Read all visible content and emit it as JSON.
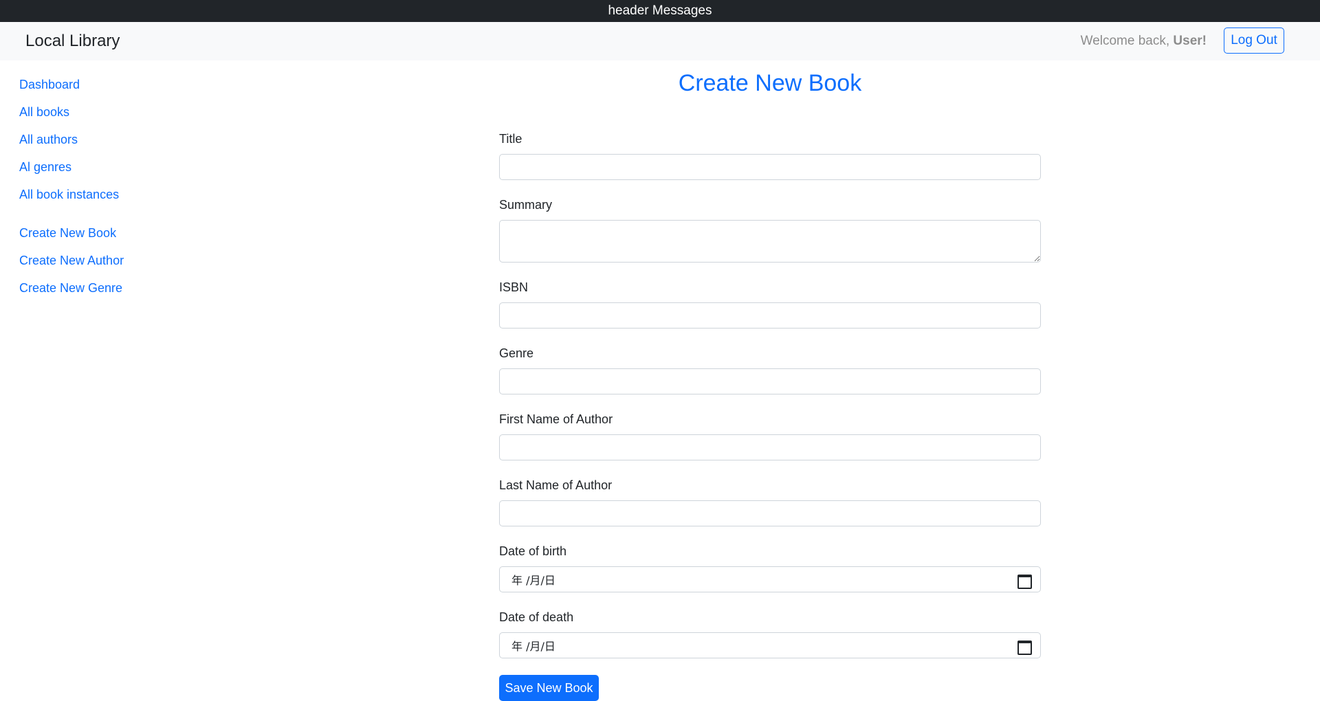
{
  "topbar": {
    "text": "header Messages"
  },
  "navbar": {
    "brand": "Local Library",
    "welcome_prefix": "Welcome back, ",
    "username": "User!",
    "logout_label": "Log Out"
  },
  "sidebar": {
    "links": [
      {
        "label": "Dashboard"
      },
      {
        "label": "All books"
      },
      {
        "label": "All authors"
      },
      {
        "label": "Al genres"
      },
      {
        "label": "All book instances"
      }
    ],
    "create_links": [
      {
        "label": "Create New Book"
      },
      {
        "label": "Create New Author"
      },
      {
        "label": "Create New Genre"
      }
    ]
  },
  "form": {
    "title": "Create New Book",
    "fields": {
      "title": {
        "label": "Title",
        "value": ""
      },
      "summary": {
        "label": "Summary",
        "value": ""
      },
      "isbn": {
        "label": "ISBN",
        "value": ""
      },
      "genre": {
        "label": "Genre",
        "value": ""
      },
      "first_name": {
        "label": "First Name of Author",
        "value": ""
      },
      "last_name": {
        "label": "Last Name of Author",
        "value": ""
      },
      "date_of_birth": {
        "label": "Date of birth",
        "placeholder": "年 /月/日"
      },
      "date_of_death": {
        "label": "Date of death",
        "placeholder": "年 /月/日"
      }
    },
    "submit_label": "Save New Book"
  },
  "colors": {
    "primary": "#0d6efd",
    "topbar_bg": "#212529",
    "navbar_bg": "#f8f9fa",
    "muted_text": "#8c8c8c"
  }
}
